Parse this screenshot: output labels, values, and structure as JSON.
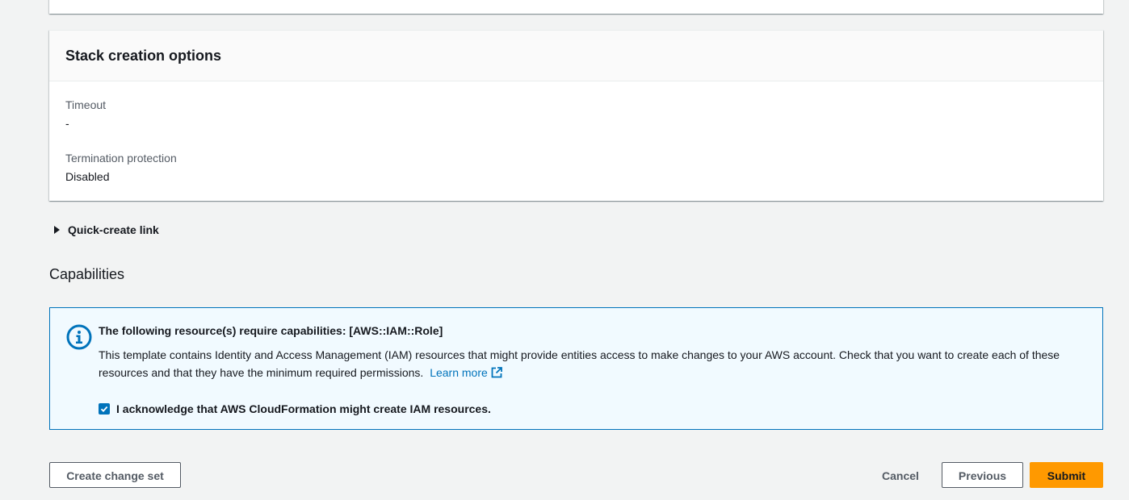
{
  "stack_options": {
    "title": "Stack creation options",
    "timeout_label": "Timeout",
    "timeout_value": "-",
    "termination_label": "Termination protection",
    "termination_value": "Disabled"
  },
  "quick_create": {
    "label": "Quick-create link",
    "expanded": false
  },
  "capabilities": {
    "heading": "Capabilities",
    "alert_title": "The following resource(s) require capabilities: [AWS::IAM::Role]",
    "alert_text": "This template contains Identity and Access Management (IAM) resources that might provide entities access to make changes to your AWS account. Check that you want to create each of these resources and that they have the minimum required permissions.",
    "learn_more": "Learn more",
    "ack_label": "I acknowledge that AWS CloudFormation might create IAM resources.",
    "ack_checked": true,
    "info_icon": "info-icon",
    "external_icon": "external-link-icon"
  },
  "footer": {
    "create_change_set": "Create change set",
    "cancel": "Cancel",
    "previous": "Previous",
    "submit": "Submit"
  },
  "colors": {
    "accent_blue": "#0073bb",
    "primary_orange": "#ff9900",
    "background": "#f2f3f3"
  }
}
